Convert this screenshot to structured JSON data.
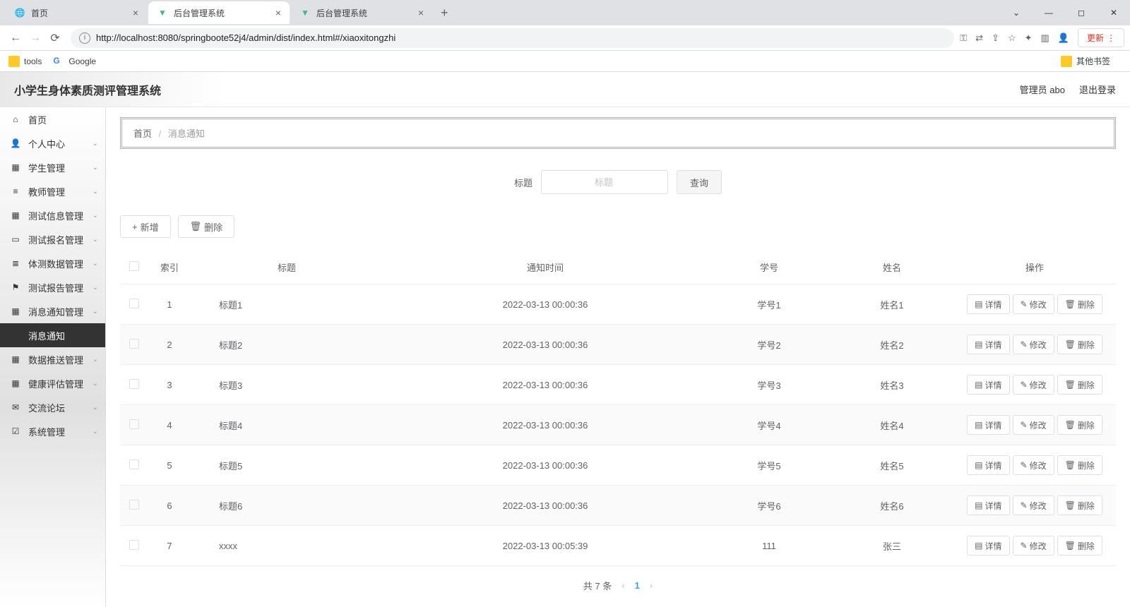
{
  "browser": {
    "tabs": [
      {
        "title": "首页",
        "icon": "globe"
      },
      {
        "title": "后台管理系统",
        "icon": "vue"
      },
      {
        "title": "后台管理系统",
        "icon": "vue"
      }
    ],
    "url": "http://localhost:8080/springboote52j4/admin/dist/index.html#/xiaoxitongzhi",
    "update_label": "更新",
    "bookmarks": [
      {
        "label": "tools"
      },
      {
        "label": "Google"
      }
    ],
    "other_bookmarks": "其他书签"
  },
  "header": {
    "app_title": "小学生身体素质测评管理系统",
    "user_label": "管理员 abo",
    "logout_label": "退出登录"
  },
  "sidebar": {
    "items": [
      {
        "label": "首页",
        "icon": "home",
        "chevron": false
      },
      {
        "label": "个人中心",
        "icon": "user",
        "chevron": true
      },
      {
        "label": "学生管理",
        "icon": "grid",
        "chevron": true
      },
      {
        "label": "教师管理",
        "icon": "list",
        "chevron": true
      },
      {
        "label": "测试信息管理",
        "icon": "grid",
        "chevron": true
      },
      {
        "label": "测试报名管理",
        "icon": "book",
        "chevron": true
      },
      {
        "label": "体测数据管理",
        "icon": "stack",
        "chevron": true
      },
      {
        "label": "测试报告管理",
        "icon": "flag",
        "chevron": true
      },
      {
        "label": "消息通知管理",
        "icon": "grid",
        "chevron": true
      },
      {
        "label": "消息通知",
        "icon": "",
        "chevron": false,
        "active": true
      },
      {
        "label": "数据推送管理",
        "icon": "grid",
        "chevron": true
      },
      {
        "label": "健康评估管理",
        "icon": "grid",
        "chevron": true
      },
      {
        "label": "交流论坛",
        "icon": "chat",
        "chevron": true
      },
      {
        "label": "系统管理",
        "icon": "check",
        "chevron": true
      }
    ]
  },
  "breadcrumb": {
    "home": "首页",
    "current": "消息通知"
  },
  "search": {
    "label": "标题",
    "placeholder": "标题",
    "button": "查询"
  },
  "actions": {
    "add": "新增",
    "delete": "删除"
  },
  "table": {
    "headers": [
      "索引",
      "标题",
      "通知时间",
      "学号",
      "姓名",
      "操作"
    ],
    "row_actions": {
      "detail": "详情",
      "edit": "修改",
      "delete": "删除"
    },
    "rows": [
      {
        "idx": "1",
        "title": "标题1",
        "time": "2022-03-13 00:00:36",
        "sid": "学号1",
        "name": "姓名1"
      },
      {
        "idx": "2",
        "title": "标题2",
        "time": "2022-03-13 00:00:36",
        "sid": "学号2",
        "name": "姓名2"
      },
      {
        "idx": "3",
        "title": "标题3",
        "time": "2022-03-13 00:00:36",
        "sid": "学号3",
        "name": "姓名3"
      },
      {
        "idx": "4",
        "title": "标题4",
        "time": "2022-03-13 00:00:36",
        "sid": "学号4",
        "name": "姓名4"
      },
      {
        "idx": "5",
        "title": "标题5",
        "time": "2022-03-13 00:00:36",
        "sid": "学号5",
        "name": "姓名5"
      },
      {
        "idx": "6",
        "title": "标题6",
        "time": "2022-03-13 00:00:36",
        "sid": "学号6",
        "name": "姓名6"
      },
      {
        "idx": "7",
        "title": "xxxx",
        "time": "2022-03-13 00:05:39",
        "sid": "111",
        "name": "张三"
      }
    ]
  },
  "pagination": {
    "total": "共 7 条",
    "current": "1"
  }
}
